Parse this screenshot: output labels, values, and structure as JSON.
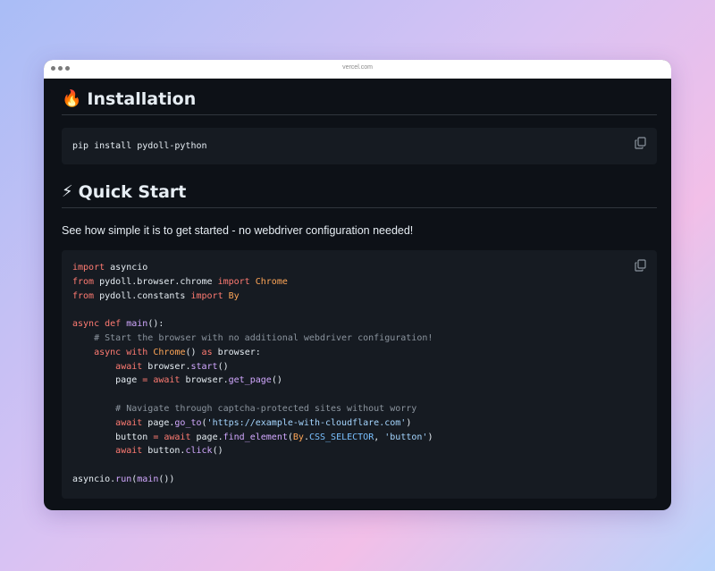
{
  "browser": {
    "url": "vercel.com"
  },
  "install": {
    "icon": "fire-emoji",
    "emoji": "🔥",
    "title": "Installation",
    "command": "pip install pydoll-python",
    "copy_icon": "copy-icon"
  },
  "quickstart": {
    "icon": "lightning-emoji",
    "emoji": "⚡",
    "title": "Quick Start",
    "intro": "See how simple it is to get started - no webdriver configuration needed!",
    "copy_icon": "copy-icon",
    "code_lines": [
      "import asyncio",
      "from pydoll.browser.chrome import Chrome",
      "from pydoll.constants import By",
      "",
      "async def main():",
      "    # Start the browser with no additional webdriver configuration!",
      "    async with Chrome() as browser:",
      "        await browser.start()",
      "        page = await browser.get_page()",
      "",
      "        # Navigate through captcha-protected sites without worry",
      "        await page.go_to('https://example-with-cloudflare.com')",
      "        button = await page.find_element(By.CSS_SELECTOR, 'button')",
      "        await button.click()",
      "",
      "asyncio.run(main())"
    ]
  },
  "colors": {
    "background": "#0d1117",
    "code_bg": "#161b22",
    "keyword": "#ff7b72",
    "function": "#d2a8ff",
    "class": "#ffa657",
    "string": "#a5d6ff",
    "comment": "#8b949e"
  }
}
